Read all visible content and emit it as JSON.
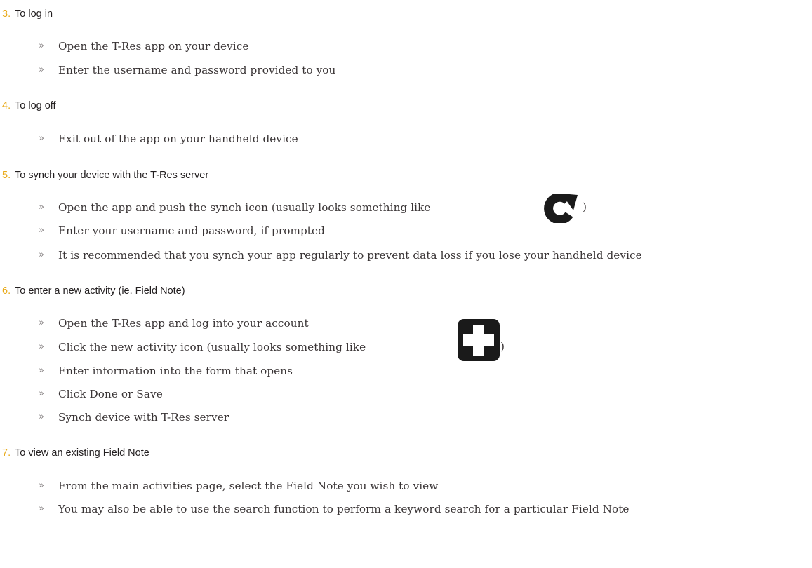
{
  "sections": [
    {
      "number": "3.",
      "title": "To log in",
      "items": [
        "Open the T-Res app on your device",
        "Enter the username and password provided to you"
      ]
    },
    {
      "number": "4.",
      "title": "To log off",
      "items": [
        "Exit out of the app on your handheld device"
      ]
    },
    {
      "number": "5.",
      "title": "To synch your device with the T-Res server",
      "items": [
        "Open the app and push the synch icon (usually looks something like",
        "Enter your username and password, if prompted",
        "It is recommended that you synch your app regularly to prevent data loss if you lose your handheld device"
      ],
      "item_suffix": ")"
    },
    {
      "number": "6.",
      "title": "To enter a new activity (ie. Field Note)",
      "items": [
        "Open the T-Res app and log into your account",
        "Click the new activity icon (usually looks something like",
        "Enter information into the form that opens",
        "Click Done or Save",
        "Synch device with T-Res server"
      ],
      "item_suffix": ")"
    },
    {
      "number": "7.",
      "title": "To view an existing Field Note",
      "items": [
        "From the main activities page, select the Field Note you wish to view",
        "You may also be able to use the search function to perform a keyword search for a particular Field Note"
      ]
    }
  ],
  "bullet_glyph": "»",
  "icons": {
    "sync": "refresh-icon",
    "add": "plus-icon"
  },
  "colors": {
    "number": "#e8a917",
    "heading": "#231f20",
    "body": "#3a3536",
    "icon": "#1a1a1a"
  }
}
